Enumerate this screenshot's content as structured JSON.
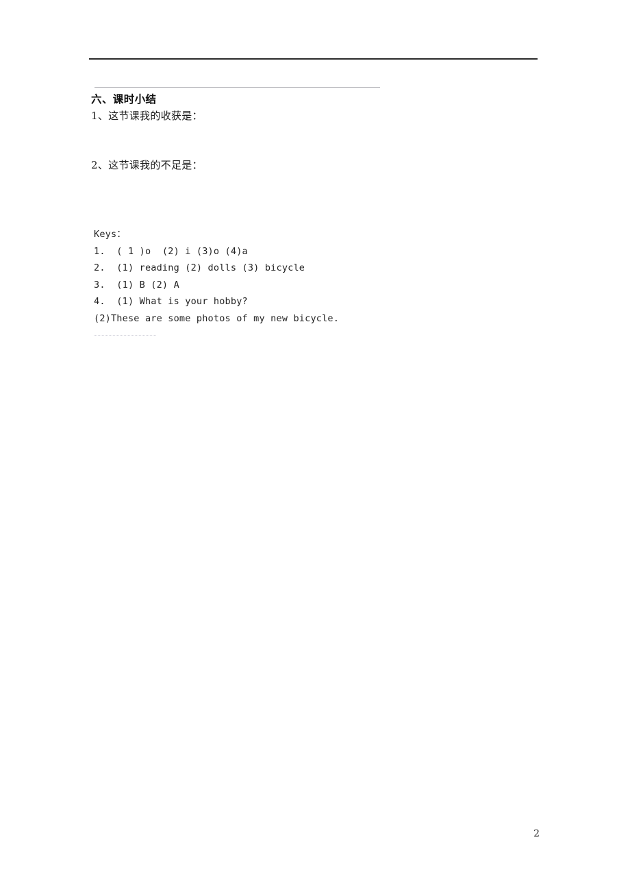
{
  "document": {
    "background_color": "#ffffff",
    "text_color": "#1a1a1a",
    "page_number": "2"
  },
  "rules": {
    "top_rule_color": "#2b2b2b",
    "sub_rule_color": "#b9b9bd",
    "dotted_rule_color": "#c9c9d4"
  },
  "section": {
    "heading": "六、课时小结",
    "prompts": [
      "1、这节课我的收获是：",
      "2、这节课我的不足是："
    ]
  },
  "answer_key": {
    "title": "Keys：",
    "lines": [
      "1.  ( 1 )o  (2) i (3)o (4)a",
      "2.  (1) reading (2) dolls (3) bicycle",
      "3.  (1) B (2) A",
      "4.  (1) What is your hobby?",
      "(2)These are some photos of my new bicycle."
    ]
  }
}
